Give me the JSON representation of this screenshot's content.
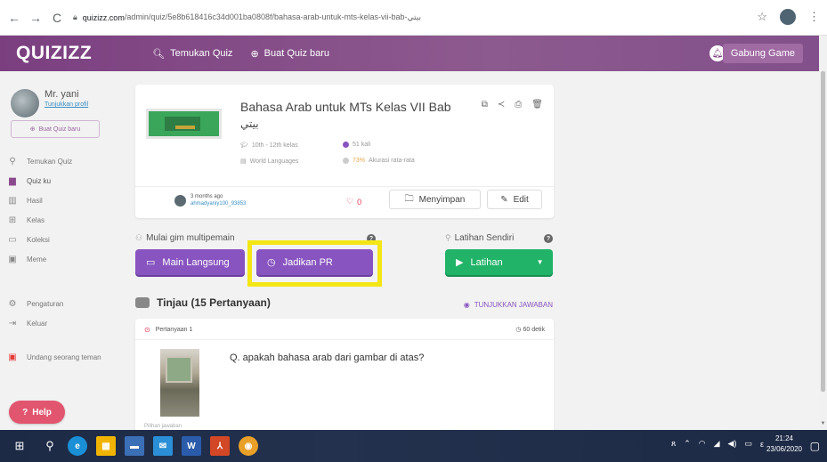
{
  "browser": {
    "url_host": "quizizz.com",
    "url_path": "/admin/quiz/5e8b618416c34d001ba0808f/bahasa-arab-untuk-mts-kelas-vii-bab-بيتي"
  },
  "header": {
    "logo": "QUIZIZZ",
    "search_link": "Temukan Quiz",
    "create_link": "Buat Quiz baru",
    "join_button": "Gabung Game",
    "accent_color": "#8b4a8e"
  },
  "sidebar": {
    "user_name": "Mr. yani",
    "profile_link": "Tunjukkan profil",
    "create_button": "Buat Quiz baru",
    "items": [
      {
        "label": "Temukan Quiz",
        "icon": "search-icon"
      },
      {
        "label": "Quiz ku",
        "icon": "document-icon"
      },
      {
        "label": "Hasil",
        "icon": "bar-chart-icon"
      },
      {
        "label": "Kelas",
        "icon": "classroom-icon"
      },
      {
        "label": "Koleksi",
        "icon": "folder-icon"
      },
      {
        "label": "Meme",
        "icon": "image-icon"
      },
      {
        "label": "Pengaturan",
        "icon": "gear-icon"
      },
      {
        "label": "Keluar",
        "icon": "logout-icon"
      },
      {
        "label": "Undang seorang teman",
        "icon": "gift-icon"
      }
    ],
    "help_button": "Help"
  },
  "quiz": {
    "title": "Bahasa Arab untuk MTs Kelas VII Bab",
    "title_arabic": "بيتي",
    "grade": "10th - 12th kelas",
    "plays": "51 kali",
    "subject": "World Languages",
    "accuracy_pct": "73%",
    "accuracy_label": "Akurasi rata-rata",
    "author_ago": "3 months ago",
    "author_name": "ahmadyaniy100_93853",
    "likes": "0",
    "save_button": "Menyimpan",
    "edit_button": "Edit"
  },
  "modes": {
    "multiplayer_label": "Mulai gim multipemain",
    "solo_label": "Latihan Sendiri",
    "live_button": "Main Langsung",
    "homework_button": "Jadikan PR",
    "practice_button": "Latihan"
  },
  "review": {
    "title": "Tinjau (15 Pertanyaan)",
    "show_answers": "TUNJUKKAN JAWABAN",
    "question_number": "Pertanyaan 1",
    "question_time": "60 detik",
    "question_text": "Q. apakah bahasa arab dari gambar di atas?",
    "options_label": "Pilihan jawaban"
  },
  "taskbar": {
    "time": "21:24",
    "date": "23/06/2020"
  }
}
